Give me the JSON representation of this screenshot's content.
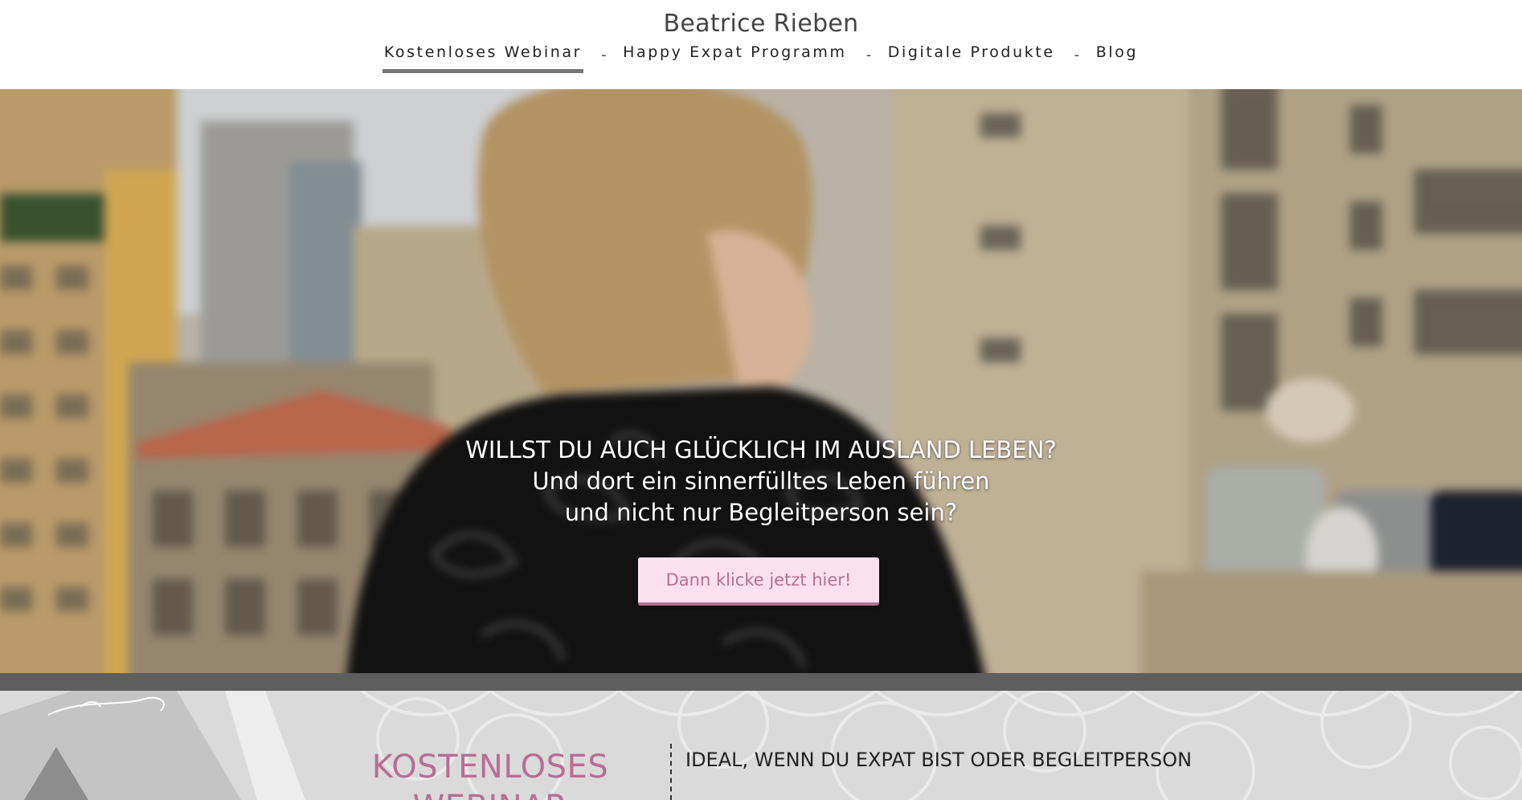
{
  "header": {
    "brand": "Beatrice Rieben",
    "nav": [
      {
        "label": "Kostenloses Webinar",
        "active": true
      },
      {
        "label": "Happy Expat Programm",
        "active": false
      },
      {
        "label": "Digitale Produkte",
        "active": false
      },
      {
        "label": "Blog",
        "active": false
      }
    ],
    "separator": "-"
  },
  "hero": {
    "line1": "WILLST DU AUCH GLÜCKLICH IM AUSLAND LEBEN?",
    "line2": "Und dort ein sinnerfülltes Leben führen",
    "line3": "und nicht nur Begleitperson sein?",
    "cta_label": "Dann klicke jetzt hier!"
  },
  "section": {
    "title": "KOSTENLOSES WEBINAR",
    "subtitle": "IDEAL, WENN DU EXPAT BIST ODER BEGLEITPERSON"
  },
  "colors": {
    "accent": "#b86e93",
    "cta_bg": "#fbe0ee",
    "band": "#5e5e5e"
  }
}
